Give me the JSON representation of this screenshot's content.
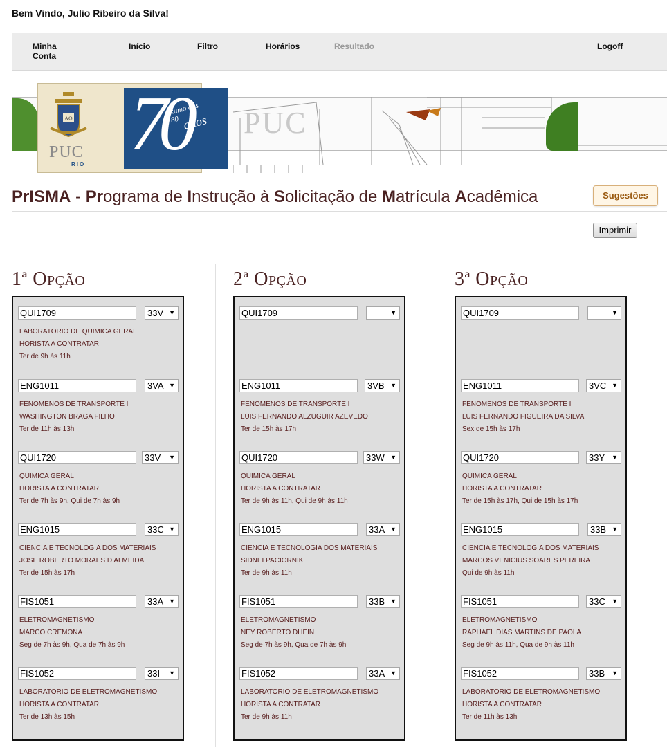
{
  "header": {
    "welcome": "Bem Vindo, Julio Ribeiro da Silva!"
  },
  "nav": {
    "minha_conta_1": "Minha",
    "minha_conta_2": "Conta",
    "inicio": "Início",
    "filtro": "Filtro",
    "horarios": "Horários",
    "resultado": "Resultado",
    "logoff": "Logoff"
  },
  "banner": {
    "puc": "PUC",
    "rio": "RIO",
    "seventy": "70",
    "rumo": "Rumo aos 80",
    "anos": "anos",
    "sign": "PUC"
  },
  "title": {
    "p1": "Pr",
    "p2": "ISMA",
    "p3": " - ",
    "p4": "Pr",
    "p5": "ograma de ",
    "p6": "I",
    "p7": "nstrução à ",
    "p8": "S",
    "p9": "olicitação de ",
    "p10": "M",
    "p11": "atrícula ",
    "p12": "A",
    "p13": "cadêmica"
  },
  "buttons": {
    "sugestoes": "Sugestões",
    "imprimir": "Imprimir"
  },
  "options": [
    {
      "heading": "1ª Opção",
      "courses": [
        {
          "code": "QUI1709",
          "turma": "33V",
          "name": "LABORATORIO DE QUIMICA GERAL",
          "teacher": "HORISTA A CONTRATAR",
          "schedule": "Ter de 9h às 11h"
        },
        {
          "code": "ENG1011",
          "turma": "3VA",
          "name": "FENOMENOS DE TRANSPORTE I",
          "teacher": "WASHINGTON BRAGA FILHO",
          "schedule": "Ter de 11h às 13h"
        },
        {
          "code": "QUI1720",
          "turma": "33V",
          "name": "QUIMICA GERAL",
          "teacher": "HORISTA A CONTRATAR",
          "schedule": "Ter de 7h às 9h, Qui de 7h às 9h"
        },
        {
          "code": "ENG1015",
          "turma": "33C",
          "name": "CIENCIA E TECNOLOGIA DOS MATERIAIS",
          "teacher": "JOSE ROBERTO MORAES D ALMEIDA",
          "schedule": "Ter de 15h às 17h"
        },
        {
          "code": "FIS1051",
          "turma": "33A",
          "name": "ELETROMAGNETISMO",
          "teacher": "MARCO CREMONA",
          "schedule": "Seg de 7h às 9h, Qua de 7h às 9h"
        },
        {
          "code": "FIS1052",
          "turma": "33I",
          "name": "LABORATORIO DE ELETROMAGNETISMO",
          "teacher": "HORISTA A CONTRATAR",
          "schedule": "Ter de 13h às 15h"
        }
      ]
    },
    {
      "heading": "2ª Opção",
      "courses": [
        {
          "code": "QUI1709",
          "turma": "",
          "name": "",
          "teacher": "",
          "schedule": ""
        },
        {
          "code": "ENG1011",
          "turma": "3VB",
          "name": "FENOMENOS DE TRANSPORTE I",
          "teacher": "LUIS FERNANDO ALZUGUIR AZEVEDO",
          "schedule": "Ter de 15h às 17h"
        },
        {
          "code": "QUI1720",
          "turma": "33W",
          "name": "QUIMICA GERAL",
          "teacher": "HORISTA A CONTRATAR",
          "schedule": "Ter de 9h às 11h, Qui de 9h às 11h"
        },
        {
          "code": "ENG1015",
          "turma": "33A",
          "name": "CIENCIA E TECNOLOGIA DOS MATERIAIS",
          "teacher": "SIDNEI PACIORNIK",
          "schedule": "Ter de 9h às 11h"
        },
        {
          "code": "FIS1051",
          "turma": "33B",
          "name": "ELETROMAGNETISMO",
          "teacher": "NEY ROBERTO DHEIN",
          "schedule": "Seg de 7h às 9h, Qua de 7h às 9h"
        },
        {
          "code": "FIS1052",
          "turma": "33A",
          "name": "LABORATORIO DE ELETROMAGNETISMO",
          "teacher": "HORISTA A CONTRATAR",
          "schedule": "Ter de 9h às 11h"
        }
      ]
    },
    {
      "heading": "3ª Opção",
      "courses": [
        {
          "code": "QUI1709",
          "turma": "",
          "name": "",
          "teacher": "",
          "schedule": ""
        },
        {
          "code": "ENG1011",
          "turma": "3VC",
          "name": "FENOMENOS DE TRANSPORTE I",
          "teacher": "LUIS FERNANDO FIGUEIRA DA SILVA",
          "schedule": "Sex de 15h às 17h"
        },
        {
          "code": "QUI1720",
          "turma": "33Y",
          "name": "QUIMICA GERAL",
          "teacher": "HORISTA A CONTRATAR",
          "schedule": "Ter de 15h às 17h, Qui de 15h às 17h"
        },
        {
          "code": "ENG1015",
          "turma": "33B",
          "name": "CIENCIA E TECNOLOGIA DOS MATERIAIS",
          "teacher": "MARCOS VENICIUS SOARES PEREIRA",
          "schedule": "Qui de 9h às 11h"
        },
        {
          "code": "FIS1051",
          "turma": "33C",
          "name": "ELETROMAGNETISMO",
          "teacher": "RAPHAEL DIAS MARTINS DE PAOLA",
          "schedule": "Seg de 9h às 11h, Qua de 9h às 11h"
        },
        {
          "code": "FIS1052",
          "turma": "33B",
          "name": "LABORATORIO DE ELETROMAGNETISMO",
          "teacher": "HORISTA A CONTRATAR",
          "schedule": "Ter de 11h às 13h"
        }
      ]
    }
  ],
  "colors": {
    "title": "#4a2222",
    "info_text": "#5a2020",
    "panel_bg": "#dedede",
    "logo_blue": "#1f4f86"
  }
}
